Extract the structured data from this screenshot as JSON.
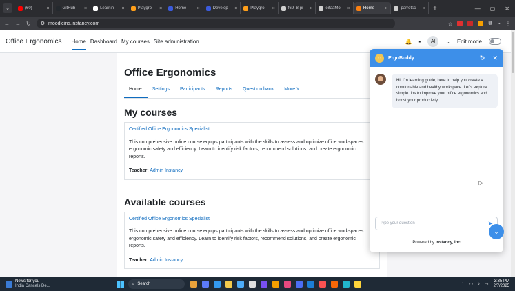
{
  "browser": {
    "tabs": [
      {
        "label": "(60)",
        "color": "#ff0000",
        "active": false
      },
      {
        "label": "GitHub",
        "color": "#24292e",
        "active": false
      },
      {
        "label": "Learnin",
        "color": "#ffffff",
        "active": false
      },
      {
        "label": "Playgro",
        "color": "#ff9f1a",
        "active": false
      },
      {
        "label": "Home",
        "color": "#3b5bdb",
        "active": false
      },
      {
        "label": "Develop",
        "color": "#3b5bdb",
        "active": false
      },
      {
        "label": "Playgro",
        "color": "#ff9f1a",
        "active": false
      },
      {
        "label": "f69_8-pr",
        "color": "#cfcfcf",
        "active": false
      },
      {
        "label": "eitaaMo",
        "color": "#cfcfcf",
        "active": false
      },
      {
        "label": "Home |",
        "color": "#f98012",
        "active": true
      },
      {
        "label": "parrotsc",
        "color": "#cfcfcf",
        "active": false
      }
    ],
    "url": "moodleins.instancy.com"
  },
  "navbar": {
    "site_name": "Office Ergonomics",
    "links": [
      "Home",
      "Dashboard",
      "My courses",
      "Site administration"
    ],
    "avatar_initials": "AI",
    "edit_mode_label": "Edit mode"
  },
  "course": {
    "title": "Office Ergonomics",
    "tabs": [
      "Home",
      "Settings",
      "Participants",
      "Reports",
      "Question bank",
      "More ˅"
    ]
  },
  "my_courses": {
    "heading": "My courses",
    "name": "Certified Office Ergonomics Specialist",
    "summary_lines": [
      "This comprehensive online course equips participants with the skills to assess and optimize office workspaces",
      "ergonomic safety and efficiency. Learn to identify risk factors, recommend solutions, and create ergonomic",
      "reports."
    ],
    "teacher_label": "Teacher:",
    "teacher_name": "Admin Instancy"
  },
  "available_courses": {
    "heading": "Available courses",
    "name": "Certified Office Ergonomics Specialist",
    "summary_lines": [
      "This comprehensive online course equips participants with the skills to assess and optimize office workspaces",
      "ergonomic safety and efficiency. Learn to identify risk factors, recommend solutions, and create ergonomic",
      "reports."
    ],
    "teacher_label": "Teacher:",
    "teacher_name": "Admin Instancy"
  },
  "chat": {
    "title": "ErgoBuddy",
    "message": "Hi! I'm learning guide, here to help you create a comfortable and healthy workspace. Let's explore simple tips to improve your office ergonomics and boost your productivity.",
    "input_placeholder": "Type your question",
    "powered_prefix": "Powered by",
    "powered_brand": "instancy, Inc",
    "accent_color": "#3d8fe9"
  },
  "taskbar": {
    "news_title": "News for you",
    "news_sub": "India Cancels De...",
    "search_label": "Search",
    "time": "3:35 PM",
    "date": "2/7/2025"
  }
}
